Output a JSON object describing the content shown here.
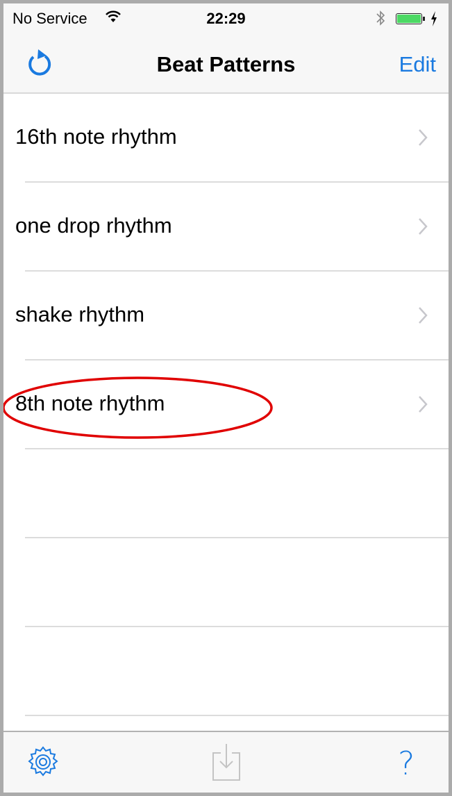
{
  "status_bar": {
    "carrier": "No Service",
    "time": "22:29",
    "wifi_icon": "wifi-icon",
    "bluetooth_icon": "bluetooth-icon",
    "battery_level": 1.0,
    "charging": true
  },
  "nav": {
    "title": "Beat Patterns",
    "left_icon": "refresh-icon",
    "edit_label": "Edit"
  },
  "list": {
    "items": [
      {
        "label": "16th note rhythm"
      },
      {
        "label": "one drop rhythm"
      },
      {
        "label": "shake rhythm"
      },
      {
        "label": "8th note rhythm",
        "highlighted": true
      },
      {
        "label": ""
      },
      {
        "label": ""
      },
      {
        "label": ""
      }
    ]
  },
  "toolbar": {
    "settings_icon": "gear-icon",
    "import_icon": "import-icon",
    "help_label": "?"
  },
  "colors": {
    "accent": "#1a7ae0",
    "highlight": "#e00000",
    "battery": "#4cd964"
  }
}
